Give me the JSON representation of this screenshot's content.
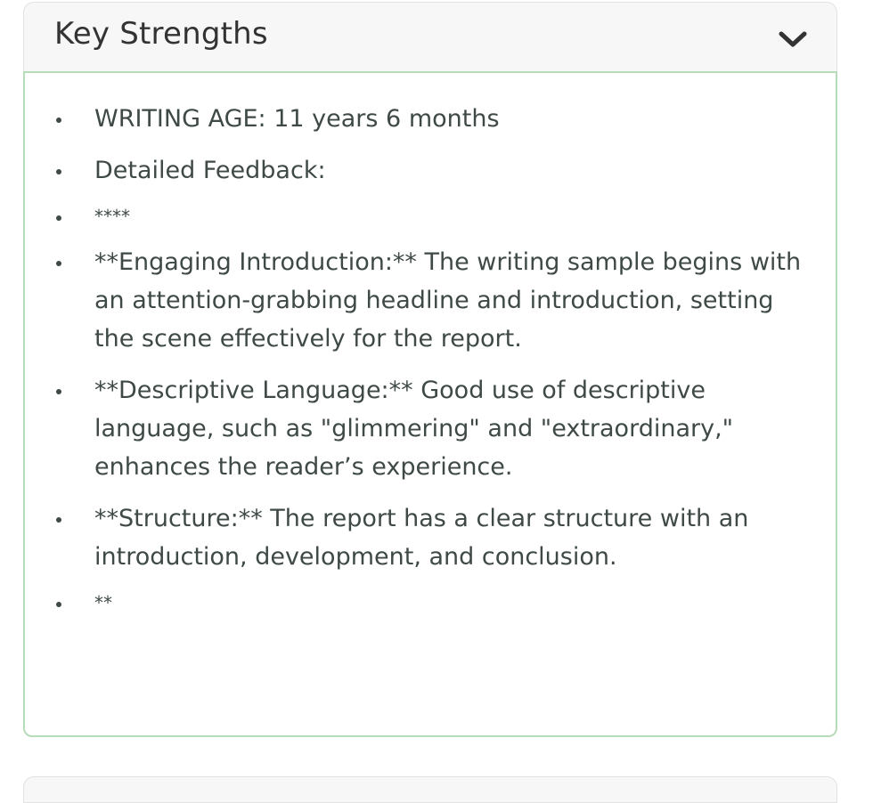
{
  "panel": {
    "title": "Key Strengths",
    "toggle_icon": "chevron-down-icon",
    "border_color": "#b7dcb9",
    "items": [
      "WRITING AGE: 11 years 6 months",
      "Detailed Feedback:",
      "****",
      "**Engaging Introduction:** The writing sample begins with an attention-grabbing headline and introduction, setting the scene effectively for the report.",
      "**Descriptive Language:** Good use of descriptive language, such as \"glimmering\" and \"extraordinary,\" enhances the reader’s experience.",
      "**Structure:** The report has a clear structure with an introduction, development, and conclusion.",
      "**"
    ]
  }
}
